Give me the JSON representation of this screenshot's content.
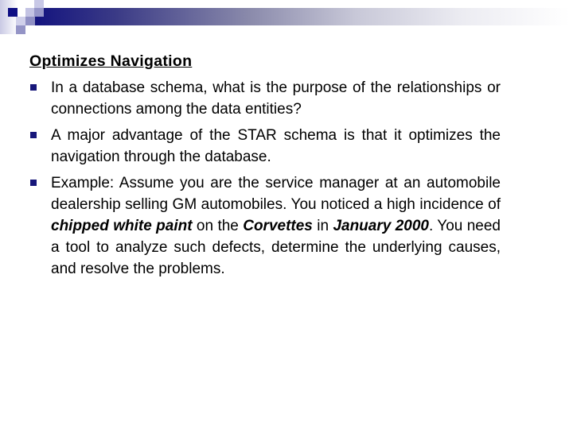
{
  "slide": {
    "title": "Optimizes Navigation",
    "bullet_icon": "square-bullet",
    "accent_color": "#17177a",
    "bullets": [
      {
        "text": "In a database schema, what is the purpose of the relationships or connections among the data entities?"
      },
      {
        "text": "A major advantage of the STAR schema is that it optimizes the navigation through the database."
      },
      {
        "segments": [
          {
            "text": "Example: Assume you are the service manager at an automobile dealership selling GM automobiles. You noticed a high incidence of ",
            "emphasis": false
          },
          {
            "text": "chipped white paint",
            "emphasis": true
          },
          {
            "text": " on the ",
            "emphasis": false
          },
          {
            "text": "Corvettes",
            "emphasis": true
          },
          {
            "text": " in ",
            "emphasis": false
          },
          {
            "text": "January 2000",
            "emphasis": true
          },
          {
            "text": ". You need a tool to analyze such defects, determine the underlying causes, and resolve the problems.",
            "emphasis": false
          }
        ]
      }
    ]
  }
}
